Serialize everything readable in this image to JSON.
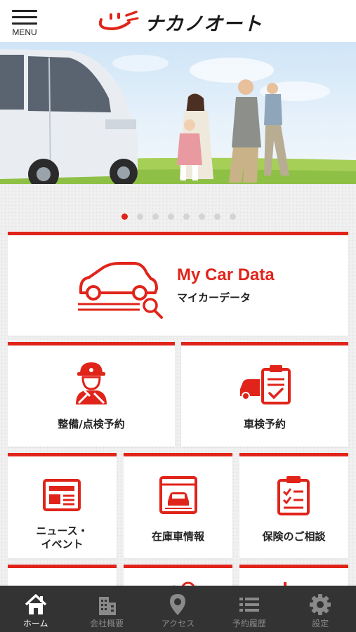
{
  "header": {
    "menu_label": "MENU",
    "brand_name": "ナカノオート"
  },
  "hero": {
    "slide_count": 8,
    "active_slide": 1
  },
  "cards": {
    "mycar": {
      "title": "My Car Data",
      "subtitle": "マイカーデータ"
    },
    "maintenance": {
      "label": "整備/点検予約"
    },
    "inspection": {
      "label": "車検予約"
    },
    "news": {
      "label_line1": "ニュース・",
      "label_line2": "イベント"
    },
    "stock": {
      "label": "在庫車情報"
    },
    "insurance": {
      "label": "保険のご相談"
    }
  },
  "tabbar": {
    "items": [
      {
        "label": "ホーム",
        "icon": "home-icon",
        "active": true
      },
      {
        "label": "会社概要",
        "icon": "building-icon",
        "active": false
      },
      {
        "label": "アクセス",
        "icon": "map-pin-icon",
        "active": false
      },
      {
        "label": "予約履歴",
        "icon": "list-icon",
        "active": false
      },
      {
        "label": "設定",
        "icon": "gear-icon",
        "active": false
      }
    ]
  },
  "colors": {
    "accent": "#e0241a",
    "tabbar_bg": "#333333",
    "card_bg": "#ffffff"
  }
}
